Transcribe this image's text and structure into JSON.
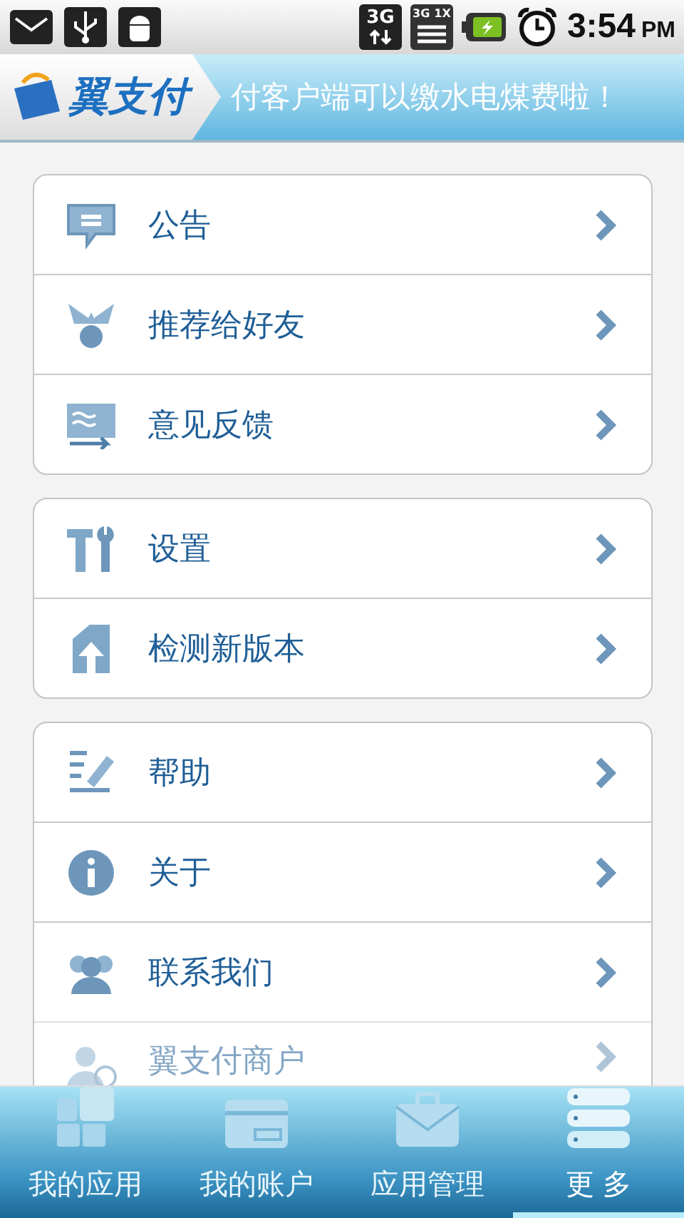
{
  "status_bar": {
    "network": "3G",
    "signal_labels": [
      "3G",
      "1X"
    ],
    "time": "3:54",
    "meridiem": "PM"
  },
  "banner": {
    "logo_text": "翼支付",
    "ticker": "付客户端可以缴水电煤费啦！"
  },
  "menu_groups": [
    {
      "items": [
        {
          "label": "公告"
        },
        {
          "label": "推荐给好友"
        },
        {
          "label": "意见反馈"
        }
      ]
    },
    {
      "items": [
        {
          "label": "设置"
        },
        {
          "label": "检测新版本"
        }
      ]
    },
    {
      "items": [
        {
          "label": "帮助"
        },
        {
          "label": "关于"
        },
        {
          "label": "联系我们"
        },
        {
          "label": "翼支付商户"
        }
      ]
    }
  ],
  "tabs": [
    {
      "label": "我的应用",
      "selected": false
    },
    {
      "label": "我的账户",
      "selected": false
    },
    {
      "label": "应用管理",
      "selected": false
    },
    {
      "label": "更 多",
      "selected": true
    }
  ]
}
